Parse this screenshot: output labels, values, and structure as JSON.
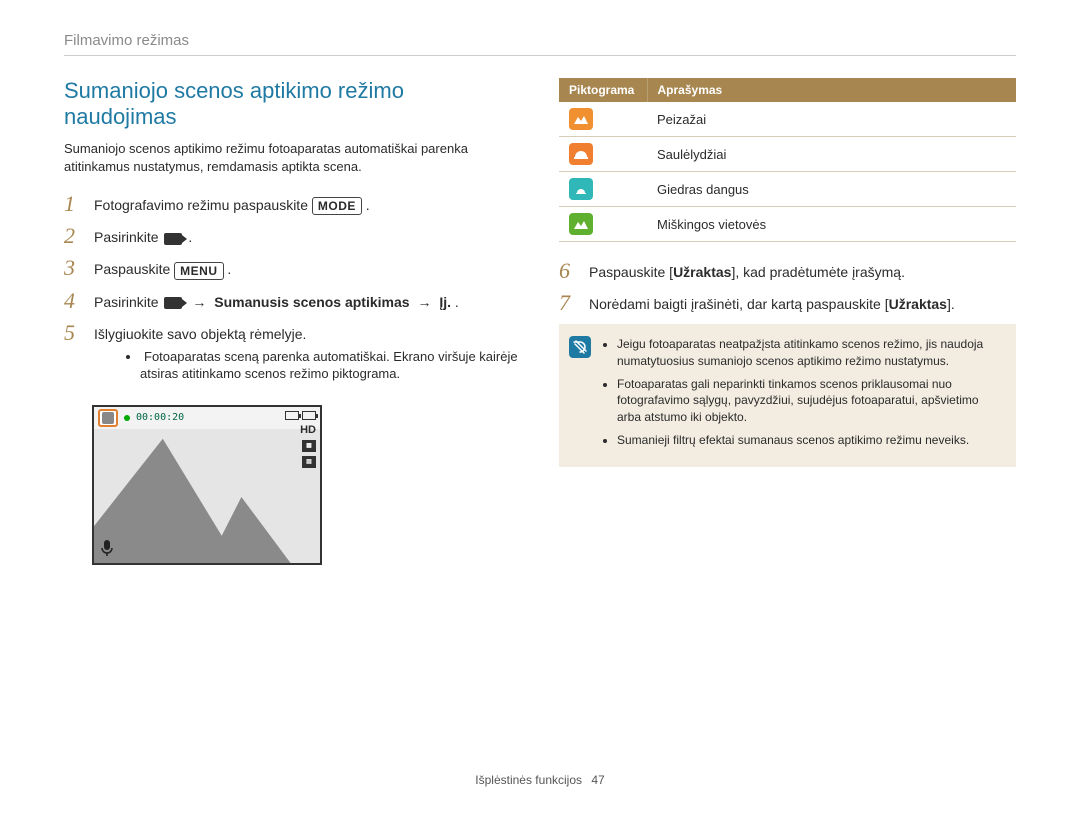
{
  "breadcrumb": "Filmavimo režimas",
  "title": "Sumaniojo scenos aptikimo režimo naudojimas",
  "intro": "Sumaniojo scenos aptikimo režimu fotoaparatas automatiškai parenka atitinkamus nustatymus, remdamasis aptikta scena.",
  "stepNums": [
    "1",
    "2",
    "3",
    "4",
    "5",
    "6",
    "7"
  ],
  "step1_a": "Fotografavimo režimu paspauskite ",
  "mode_chip": "MODE",
  "step1_b": ".",
  "step2_a": "Pasirinkite ",
  "step2_b": ".",
  "step3_a": "Paspauskite ",
  "menu_chip": "MENU",
  "step3_b": ".",
  "step4_a": "Pasirinkite ",
  "step4_b": " → ",
  "step4_bold1": "Sumanusis scenos aptikimas",
  "step4_c": " → ",
  "step4_bold2": "Įj.",
  "step4_d": ".",
  "step5": "Išlygiuokite savo objektą rėmelyje.",
  "step5_sub": "Fotoaparatas sceną parenka automatiškai. Ekrano viršuje kairėje atsiras atitinkamo scenos režimo piktograma.",
  "preview": {
    "timecode": "00:00:20",
    "hd": "HD"
  },
  "table": {
    "headers": [
      "Piktograma",
      "Aprašymas"
    ],
    "rows": [
      {
        "label": "Peizažai"
      },
      {
        "label": "Saulėlydžiai"
      },
      {
        "label": "Giedras dangus"
      },
      {
        "label": "Miškingos vietovės"
      }
    ]
  },
  "step6_a": "Paspauskite [",
  "step6_bold": "Užraktas",
  "step6_b": "], kad pradėtumėte įrašymą.",
  "step7_a": "Norėdami baigti įrašinėti, dar kartą paspauskite [",
  "step7_bold": "Užraktas",
  "step7_b": "].",
  "notes": [
    "Jeigu fotoaparatas neatpažįsta atitinkamo scenos režimo, jis naudoja numatytuosius sumaniojo scenos aptikimo režimo nustatymus.",
    "Fotoaparatas gali neparinkti tinkamos scenos priklausomai nuo fotografavimo sąlygų, pavyzdžiui, sujudėjus fotoaparatui, apšvietimo arba atstumo iki objekto.",
    "Sumanieji filtrų efektai sumanaus scenos aptikimo režimu neveiks."
  ],
  "footer_label": "Išplėstinės funkcijos",
  "footer_page": "47"
}
